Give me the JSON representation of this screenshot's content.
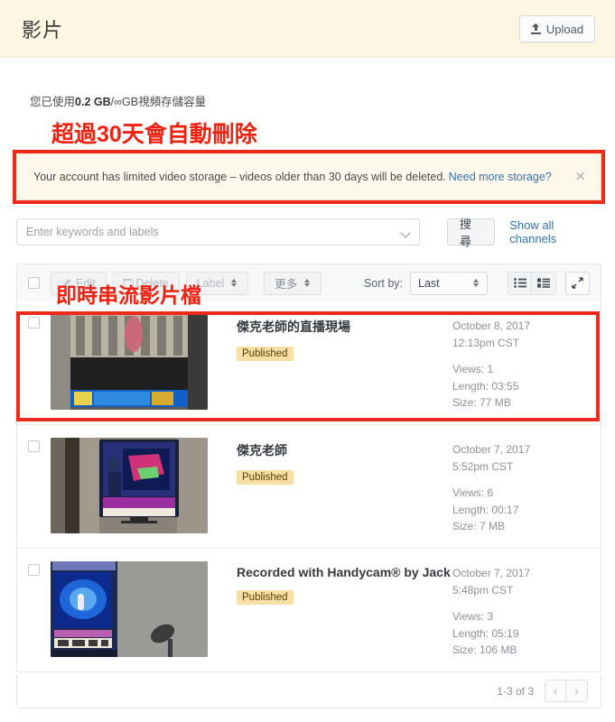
{
  "header": {
    "title": "影片",
    "upload_label": "Upload",
    "upload_icon": "upload-icon",
    "bg_color": "#fdf6e3"
  },
  "storage": {
    "prefix": "您已使用",
    "used": "0.2 GB",
    "separator": "/",
    "quota": "∞GB",
    "suffix": "視頻存儲容量"
  },
  "annotations": {
    "color": "#ee2211",
    "text_1": "超過30天會自動刪除",
    "text_2": "即時串流影片檔"
  },
  "banner": {
    "message": "Your account has limited video storage – videos older than 30 days will be deleted.",
    "link_label": "Need more storage?",
    "close_icon": "close-icon",
    "bg_color": "#fdf8ec",
    "link_color": "#3572b0"
  },
  "search": {
    "placeholder": "Enter keywords and labels",
    "value": "",
    "dropdown_icon": "chevron-down-icon",
    "search_label": "搜尋",
    "show_all_label": "Show all channels"
  },
  "toolbar": {
    "select_all_name": "select-all-checkbox",
    "edit_label": "Edit",
    "edit_icon": "pencil-icon",
    "delete_label": "Delete",
    "delete_icon": "trash-icon",
    "label_label": "Label",
    "more_label": "更多",
    "sort_by_label": "Sort by:",
    "sort_value": "Last",
    "list_view_icon": "list-view-icon",
    "grid_view_icon": "grid-view-icon",
    "expand_icon": "expand-icon"
  },
  "videos": [
    {
      "title": "傑克老師的直播現場",
      "status": "Published",
      "date": "October 8, 2017",
      "time": "12:13pm CST",
      "views": "Views: 1",
      "length": "Length: 03:55",
      "size": "Size: 77 MB",
      "thumb_alt": "tv-news-ticker-thumbnail"
    },
    {
      "title": "傑克老師",
      "status": "Published",
      "date": "October 7, 2017",
      "time": "5:52pm CST",
      "views": "Views: 6",
      "length": "Length: 00:17",
      "size": "Size: 7 MB",
      "thumb_alt": "tv-weather-broadcast-thumbnail"
    },
    {
      "title": "Recorded with Handycam® by Jack",
      "status": "Published",
      "date": "October 7, 2017",
      "time": "5:48pm CST",
      "views": "Views: 3",
      "length": "Length: 05:19",
      "size": "Size: 106 MB",
      "thumb_alt": "tv-blue-screen-thumbnail"
    }
  ],
  "footer": {
    "range_label": "1-3 of 3",
    "prev_icon": "chevron-left-icon",
    "next_icon": "chevron-right-icon",
    "prev_label": "‹",
    "next_label": "›"
  }
}
